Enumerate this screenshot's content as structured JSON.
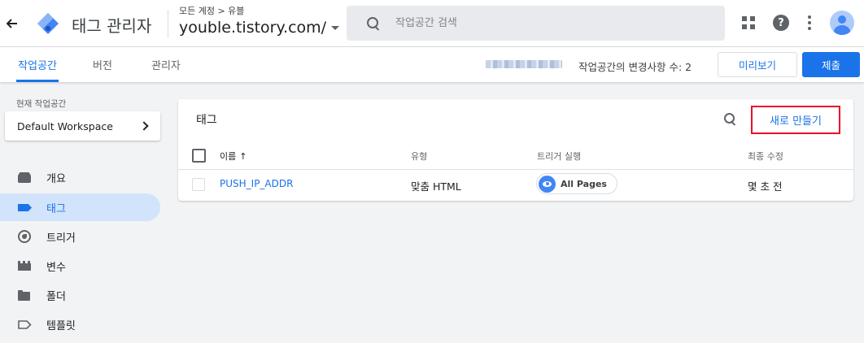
{
  "header": {
    "back_icon": "arrow-back-icon",
    "app_title": "태그 관리자",
    "breadcrumb": "모든 계정 > 유블",
    "container_name": "youble.tistory.com/",
    "search": {
      "placeholder": "작업공간 검색"
    },
    "icons": [
      "apps-icon",
      "help-icon",
      "more-vert-icon",
      "account-avatar"
    ]
  },
  "subnav": {
    "tabs": [
      {
        "label": "작업공간",
        "active": true
      },
      {
        "label": "버전",
        "active": false
      },
      {
        "label": "관리자",
        "active": false
      }
    ],
    "change_count_label": "작업공간의 변경사항 수: 2",
    "preview_label": "미리보기",
    "submit_label": "제출"
  },
  "sidebar": {
    "current_workspace_label": "현재 작업공간",
    "workspace_name": "Default Workspace",
    "items": [
      {
        "label": "개요",
        "icon": "overview-icon",
        "active": false
      },
      {
        "label": "태그",
        "icon": "tag-icon",
        "active": true
      },
      {
        "label": "트리거",
        "icon": "trigger-icon",
        "active": false
      },
      {
        "label": "변수",
        "icon": "variable-icon",
        "active": false
      },
      {
        "label": "폴더",
        "icon": "folder-icon",
        "active": false
      },
      {
        "label": "템플릿",
        "icon": "template-icon",
        "active": false
      }
    ]
  },
  "tags_card": {
    "title": "태그",
    "new_button_label": "새로 만들기",
    "columns": {
      "name": "이름",
      "sort": "↑",
      "type": "유형",
      "trigger": "트리거 실행",
      "edited": "최종 수정"
    },
    "rows": [
      {
        "name": "PUSH_IP_ADDR",
        "type": "맞춤 HTML",
        "trigger": "All Pages",
        "edited": "몇 초 전"
      }
    ]
  },
  "colors": {
    "accent": "#1a73e8",
    "highlight_border": "#e8102a",
    "active_nav_bg": "#d2e3fc"
  }
}
